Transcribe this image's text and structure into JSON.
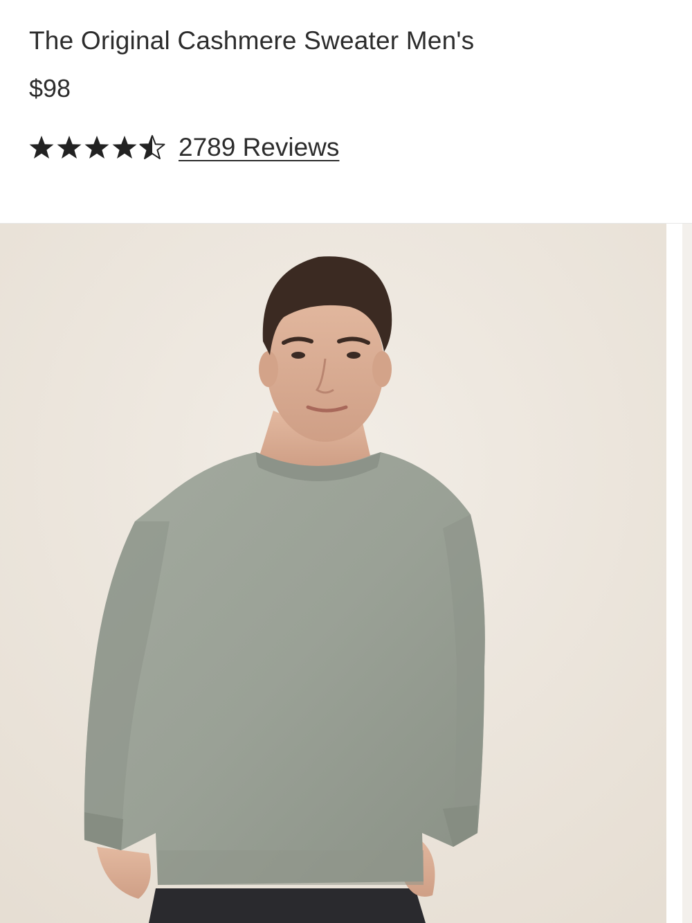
{
  "product": {
    "title": "The Original Cashmere Sweater Men's",
    "price": "$98",
    "rating": {
      "value": 4.5,
      "max": 5,
      "reviews_label": "2789 Reviews",
      "star_color": "#222222"
    }
  },
  "gallery": {
    "image_icon": "product-photo-model-in-sage-sweater",
    "background_color": "#ede7df",
    "sweater_color": "#9aa196"
  }
}
